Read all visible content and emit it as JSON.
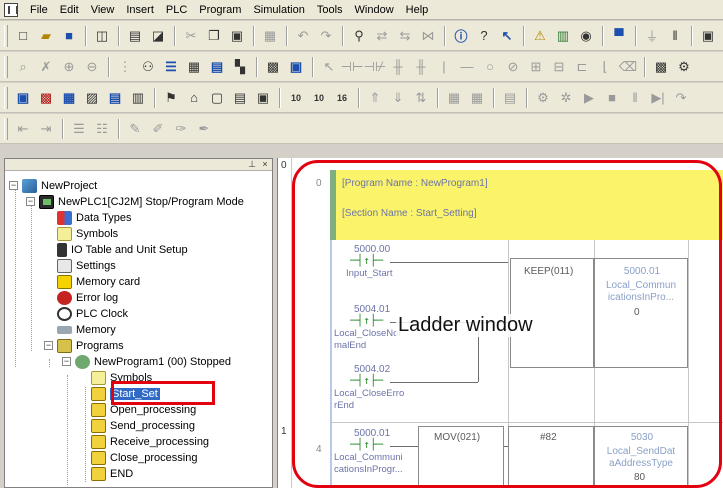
{
  "menubar": {
    "items": [
      "File",
      "Edit",
      "View",
      "Insert",
      "PLC",
      "Program",
      "Simulation",
      "Tools",
      "Window",
      "Help"
    ]
  },
  "tree": {
    "root": "NewProject",
    "plc": "NewPLC1[CJ2M] Stop/Program Mode",
    "nodes": [
      "Data Types",
      "Symbols",
      "IO Table and Unit Setup",
      "Settings",
      "Memory card",
      "Error log",
      "PLC Clock",
      "Memory",
      "Programs"
    ],
    "program": "NewProgram1 (00) Stopped",
    "program_children": [
      "Symbols",
      "Start_Set",
      "Open_processing",
      "Send_processing",
      "Receive_processing",
      "Close_processing",
      "END"
    ]
  },
  "ladder": {
    "header_rung": "0",
    "header_step": "0",
    "program_name": "[Program Name : NewProgram1]",
    "section_name": "[Section Name : Start_Setting]",
    "contacts": [
      {
        "addr": "5000.00",
        "label": "Input_Start"
      },
      {
        "addr": "5004.01",
        "label": "Local_CloseNor\nmalEnd"
      },
      {
        "addr": "5004.02",
        "label": "Local_CloseErro\nrEnd"
      }
    ],
    "keep": {
      "name": "KEEP(011)",
      "addr": "5000.01",
      "label": "Local_Commun\nicationsInPro...",
      "value": "0"
    },
    "rung2": {
      "rung_num": "1",
      "step": "4",
      "contact_addr": "5000.01",
      "contact_label": "Local_Communi\ncationsInProgr...",
      "instr": "MOV(021)",
      "operand": "#82",
      "dest_addr": "5030",
      "dest_label": "Local_SendDat\naAddressType",
      "dest_value": "80"
    },
    "caption": "Ladder window"
  },
  "colors": {
    "highlight": "#e3000f",
    "comment_band": "#fbf46b",
    "selection": "#316ac5"
  }
}
